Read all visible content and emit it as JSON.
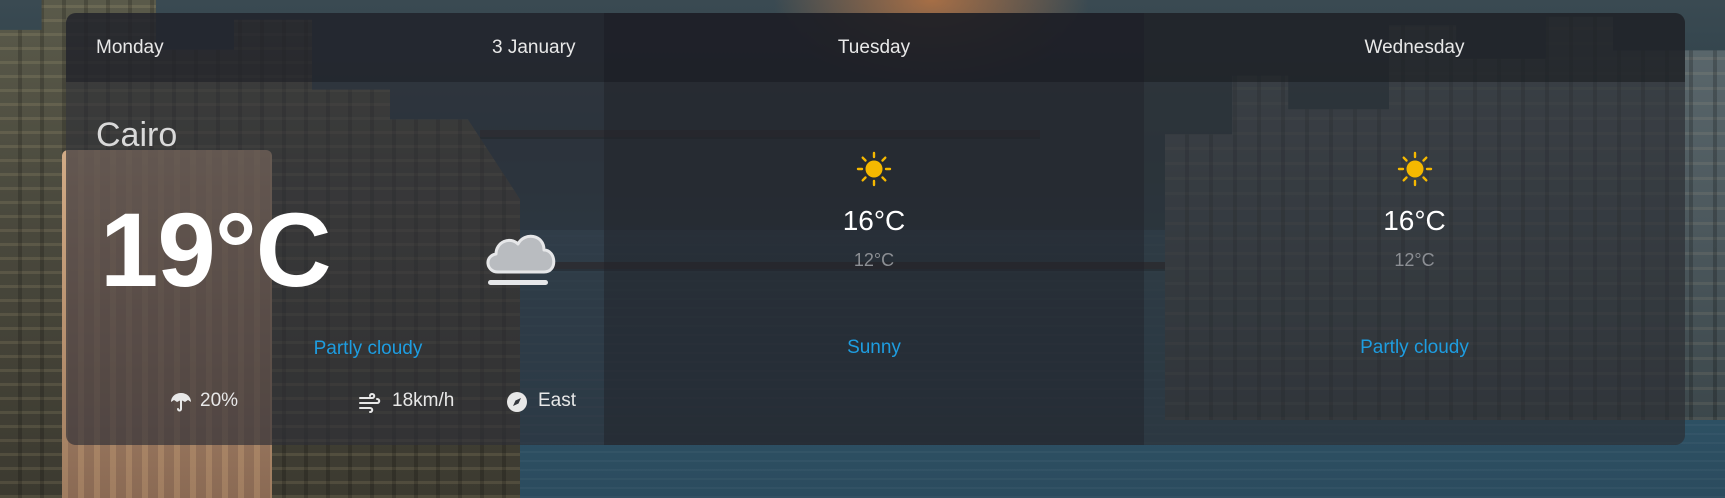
{
  "today": {
    "day": "Monday",
    "date": "3 January",
    "city": "Cairo",
    "temperature": "19°C",
    "condition": "Partly cloudy",
    "condition_icon": "cloud-fog-icon",
    "rain_chance": "20%",
    "wind_speed": "18km/h",
    "wind_direction": "East"
  },
  "forecast": [
    {
      "day": "Tuesday",
      "icon": "sun-icon",
      "max_temp": "16°C",
      "min_temp": "12°C",
      "condition": "Sunny"
    },
    {
      "day": "Wednesday",
      "icon": "sun-icon",
      "max_temp": "16°C",
      "min_temp": "12°C",
      "condition": "Partly cloudy"
    }
  ],
  "colors": {
    "accent": "#1e9de0",
    "sun": "#f5b800",
    "muted": "#8c8f94"
  }
}
